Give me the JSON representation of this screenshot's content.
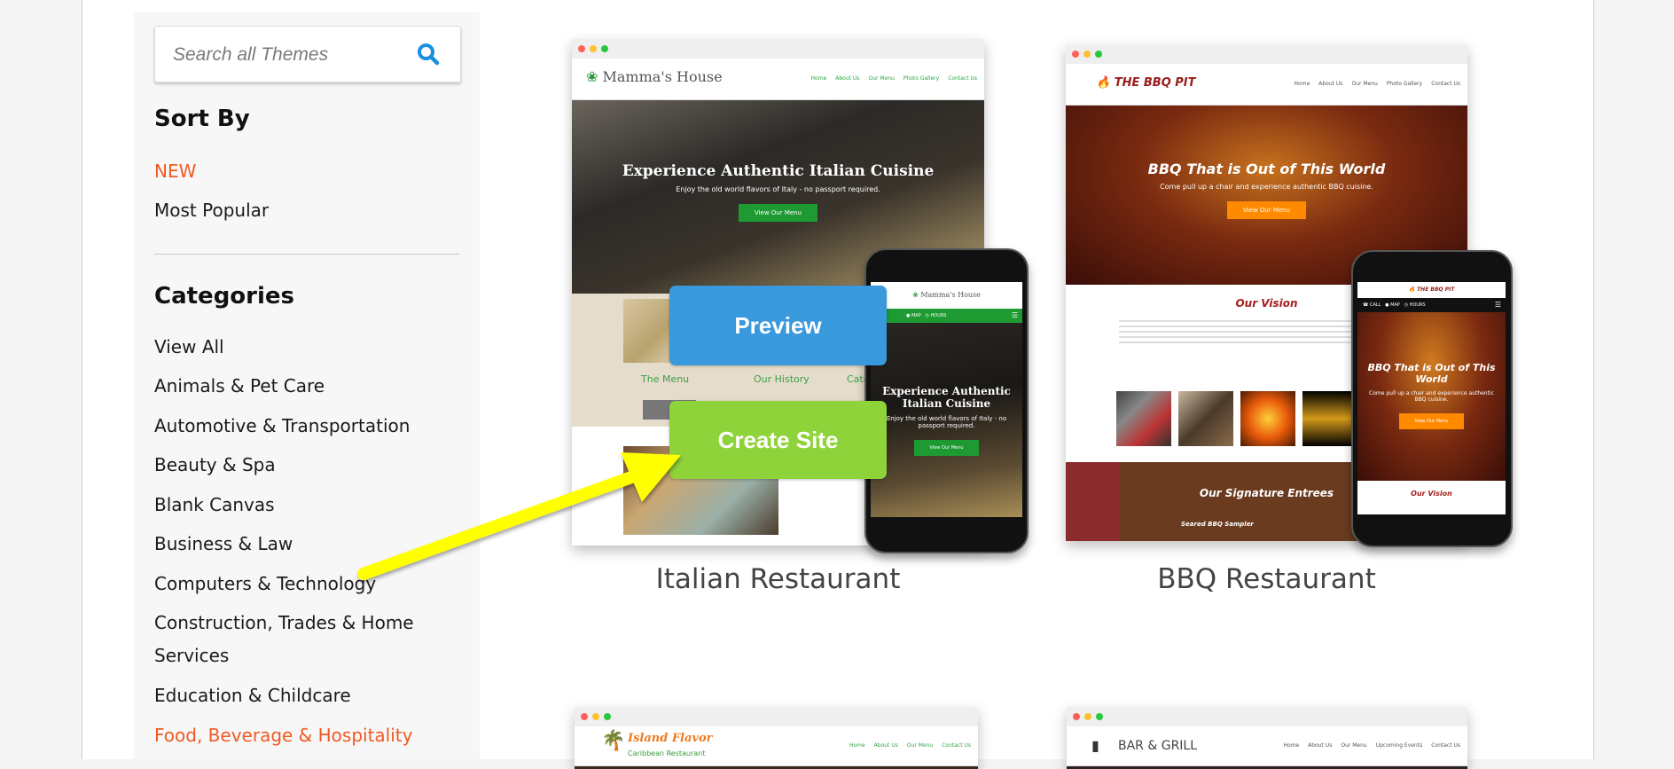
{
  "search": {
    "placeholder": "Search all Themes",
    "value": "",
    "icon": "search-icon"
  },
  "sort": {
    "heading": "Sort By",
    "options": [
      {
        "label": "NEW",
        "active": true
      },
      {
        "label": "Most Popular",
        "active": false
      }
    ]
  },
  "categories": {
    "heading": "Categories",
    "items": [
      {
        "label": "View All",
        "active": false
      },
      {
        "label": "Animals & Pet Care",
        "active": false
      },
      {
        "label": "Automotive & Transportation",
        "active": false
      },
      {
        "label": "Beauty & Spa",
        "active": false
      },
      {
        "label": "Blank Canvas",
        "active": false
      },
      {
        "label": "Business & Law",
        "active": false
      },
      {
        "label": "Computers & Technology",
        "active": false
      },
      {
        "label": "Construction, Trades & Home Services",
        "active": false
      },
      {
        "label": "Education & Childcare",
        "active": false
      },
      {
        "label": "Food, Beverage & Hospitality",
        "active": true
      }
    ]
  },
  "themes": [
    {
      "title": "Italian Restaurant",
      "site_name": "Mamma's House",
      "nav": [
        "Home",
        "About Us",
        "Our Menu",
        "Photo Gallery",
        "Contact Us"
      ],
      "hero_title": "Experience Authentic Italian Cuisine",
      "hero_subtitle": "Enjoy the old world flavors of Italy - no passport required.",
      "hero_cta": "View Our Menu",
      "sections": [
        "The Menu",
        "Our History",
        "Cate"
      ],
      "mobile_bar": [
        "MAP",
        "HOURS"
      ],
      "accent": "#1e9a32"
    },
    {
      "title": "BBQ Restaurant",
      "site_name": "THE BBQ PIT",
      "nav": [
        "Home",
        "About Us",
        "Our Menu",
        "Photo Gallery",
        "Contact Us"
      ],
      "hero_title": "BBQ That is Out of This World",
      "hero_subtitle": "Come pull up a chair and experience authentic BBQ cuisine.",
      "hero_cta": "View Our Menu",
      "sections": [
        "Our Vision",
        "Our Signature Entrees",
        "Seared BBQ Sampler"
      ],
      "mobile_bar": [
        "CALL",
        "MAP",
        "HOURS"
      ],
      "accent": "#ff8a00"
    },
    {
      "site_name": "Island Flavor",
      "site_tagline": "Caribbean Restaurant",
      "nav": [
        "Home",
        "About Us",
        "Our Menu",
        "Contact Us"
      ]
    },
    {
      "site_name": "BAR & GRILL",
      "nav": [
        "Home",
        "About Us",
        "Our Menu",
        "Upcoming Events",
        "Contact Us"
      ]
    }
  ],
  "overlay": {
    "preview_label": "Preview",
    "create_label": "Create Site"
  },
  "colors": {
    "accent_orange": "#f05a22",
    "preview_blue": "#3a98dc",
    "create_green": "#8fd33a",
    "search_blue": "#1a8fe0",
    "arrow_yellow": "#ffff00"
  }
}
